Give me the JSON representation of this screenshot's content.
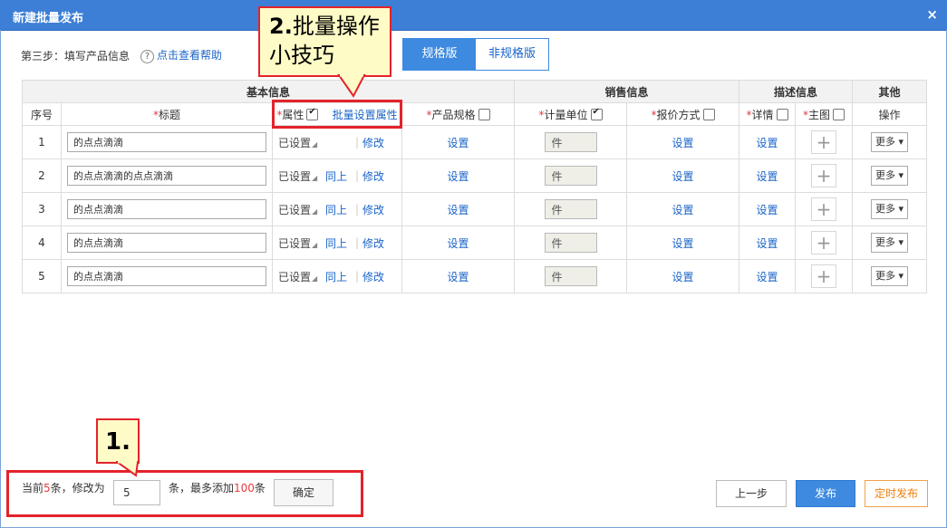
{
  "window": {
    "title": "新建批量发布",
    "close": "×"
  },
  "step": {
    "text": "第三步：填写产品信息",
    "help": "点击查看帮助",
    "help_icon": "?"
  },
  "version_tabs": [
    {
      "label": "规格版",
      "active": true
    },
    {
      "label": "非规格版",
      "active": false
    }
  ],
  "table": {
    "groups": [
      "基本信息",
      "销售信息",
      "描述信息",
      "其他"
    ],
    "columns": {
      "index": "序号",
      "title": "标题",
      "attr": "属性",
      "batch_attr": "批量设置属性",
      "spec": "产品规格",
      "unit": "计量单位",
      "price": "报价方式",
      "detail": "详情",
      "image": "主图",
      "ops": "操作"
    },
    "rows": [
      {
        "index": "1",
        "title": "的点点滴滴",
        "attr": "已设置",
        "same": "",
        "edit": "修改",
        "spec": "设置",
        "unit": "件",
        "price": "设置",
        "detail": "设置",
        "image": "+",
        "more": "更多"
      },
      {
        "index": "2",
        "title": "的点点滴滴的点点滴滴",
        "attr": "已设置",
        "same": "同上",
        "edit": "修改",
        "spec": "设置",
        "unit": "件",
        "price": "设置",
        "detail": "设置",
        "image": "+",
        "more": "更多"
      },
      {
        "index": "3",
        "title": "的点点滴滴",
        "attr": "已设置",
        "same": "同上",
        "edit": "修改",
        "spec": "设置",
        "unit": "件",
        "price": "设置",
        "detail": "设置",
        "image": "+",
        "more": "更多"
      },
      {
        "index": "4",
        "title": "的点点滴滴",
        "attr": "已设置",
        "same": "同上",
        "edit": "修改",
        "spec": "设置",
        "unit": "件",
        "price": "设置",
        "detail": "设置",
        "image": "+",
        "more": "更多"
      },
      {
        "index": "5",
        "title": "的点点滴滴",
        "attr": "已设置",
        "same": "同上",
        "edit": "修改",
        "spec": "设置",
        "unit": "件",
        "price": "设置",
        "detail": "设置",
        "image": "+",
        "more": "更多"
      }
    ]
  },
  "footer": {
    "current_prefix": "当前",
    "current_count": "5",
    "current_suffix": "条，修改为",
    "count_value": "5",
    "max_prefix": "条，最多添加",
    "max_count": "100",
    "max_suffix": "条",
    "confirm": "确定",
    "prev": "上一步",
    "publish": "发布",
    "scheduled": "定时发布"
  },
  "annotations": {
    "tip2_num": "2.",
    "tip2_text": "批量操作小技巧",
    "tip1": "1."
  },
  "colors": {
    "accent": "#3d8ae0",
    "titlebar": "#3d7fd6",
    "required": "#e4393c",
    "highlight": "#e3232b",
    "callout_bg": "#fffbc6"
  }
}
